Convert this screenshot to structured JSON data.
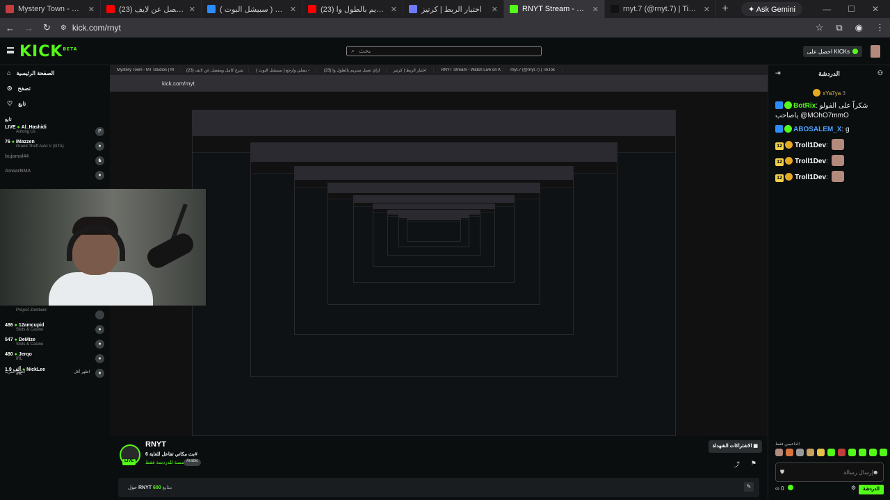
{
  "browser": {
    "tabs": [
      {
        "title": "Mystery Town - MT Studios | M",
        "color": "#c43d3d"
      },
      {
        "title": "(23) شرح كامل ومفصل عن لايف",
        "color": "#ff0000"
      },
      {
        "title": "يصلي وارجع ( سبيشل البوت ) -",
        "color": "#2a8cff"
      },
      {
        "title": "(23) ازاي تعمل ستريم بالطول وا",
        "color": "#ff0000"
      },
      {
        "title": "اختيار الربط | كرتيز",
        "color": "#6e7bff"
      },
      {
        "title": "RNYT Stream - Watch Live on K",
        "color": "#53fc18"
      },
      {
        "title": "rnyt.7 (@rnyt.7) | TikTok",
        "color": "#111111"
      }
    ],
    "active_tab_index": 5,
    "new_tab_glyph": "+",
    "gemini_label": "Ask Gemini",
    "url": "kick.com/rnyt"
  },
  "header": {
    "logo": "KICK",
    "logo_sup": "BETA",
    "search_placeholder": "بحث",
    "get_kicks_label": "احصل على KICKs"
  },
  "sidebar": {
    "nav": [
      {
        "label": "الصفحة الرئيسية",
        "icon": "home-icon"
      },
      {
        "label": "تصفح",
        "icon": "browse-icon"
      },
      {
        "label": "تابع",
        "icon": "heart-icon"
      }
    ],
    "following_header": "تابع",
    "channels_top": [
      {
        "prefix": "LIVE",
        "name": "Al_Hashidi",
        "category": "Among Us",
        "icon": "P"
      },
      {
        "prefix": "76",
        "name": "iMazzen",
        "category": "Grand Theft Auto V (GTA)",
        "icon": "●"
      },
      {
        "prefix": "",
        "name": "bujamal44",
        "category": "",
        "icon": "♞",
        "offline": true
      },
      {
        "prefix": "",
        "name": "AnwarBMA",
        "category": "",
        "icon": "●",
        "offline": true
      }
    ],
    "channels_bottom": [
      {
        "prefix": "",
        "name": "",
        "category": "Project Zomboid",
        "icon": ""
      },
      {
        "prefix": "486",
        "name": "12amcupid",
        "category": "Slots & Casino",
        "icon": "●"
      },
      {
        "prefix": "547",
        "name": "DeMize",
        "category": "Slots & Casino",
        "icon": "●"
      },
      {
        "prefix": "480",
        "name": "Jerqo",
        "category": "IRL",
        "icon": "●"
      },
      {
        "prefix": "1.9 ألف",
        "name": "NickLee",
        "category": "IRL",
        "icon": "●"
      }
    ],
    "show_more": "اظهر المزيد",
    "show_less": "اظهر أقل"
  },
  "chat": {
    "title": "الدردشة",
    "pinned_user": "xYa7ya",
    "pinned_count": "3",
    "messages": [
      {
        "user": "BotRix",
        "user_color": "#53fc18",
        "text": "شكراً على الفولو ياصاحب @MOhO7mmO"
      },
      {
        "user": "ABOSALEM_X",
        "user_color": "#4aa3ff",
        "text": "g"
      },
      {
        "user": "Troll1Dev",
        "user_color": "#ffffff",
        "level": "12",
        "text": ""
      },
      {
        "user": "Troll1Dev",
        "user_color": "#ffffff",
        "level": "12",
        "text": ""
      },
      {
        "user": "Troll1Dev",
        "user_color": "#ffffff",
        "level": "12",
        "text": ""
      }
    ],
    "supporters_label": "الداعمين فقط",
    "input_placeholder": "إرسال رسالة",
    "count": "0",
    "send_label": "الدردشة"
  },
  "stream": {
    "name": "RNYT",
    "title": "بث مكاتي تفاعل للغاية 6#",
    "category": "مخصصة للدردشة فقط",
    "language_tag": "Arabic",
    "live_label": "LIVE",
    "subs_label": "الاشتراكات الشهداة",
    "about_prefix": "حول",
    "about_name": "RNYT",
    "followers": "600",
    "followers_label": "متابع"
  },
  "colors": {
    "accent": "#53fc18",
    "background": "#0b0e0f"
  }
}
